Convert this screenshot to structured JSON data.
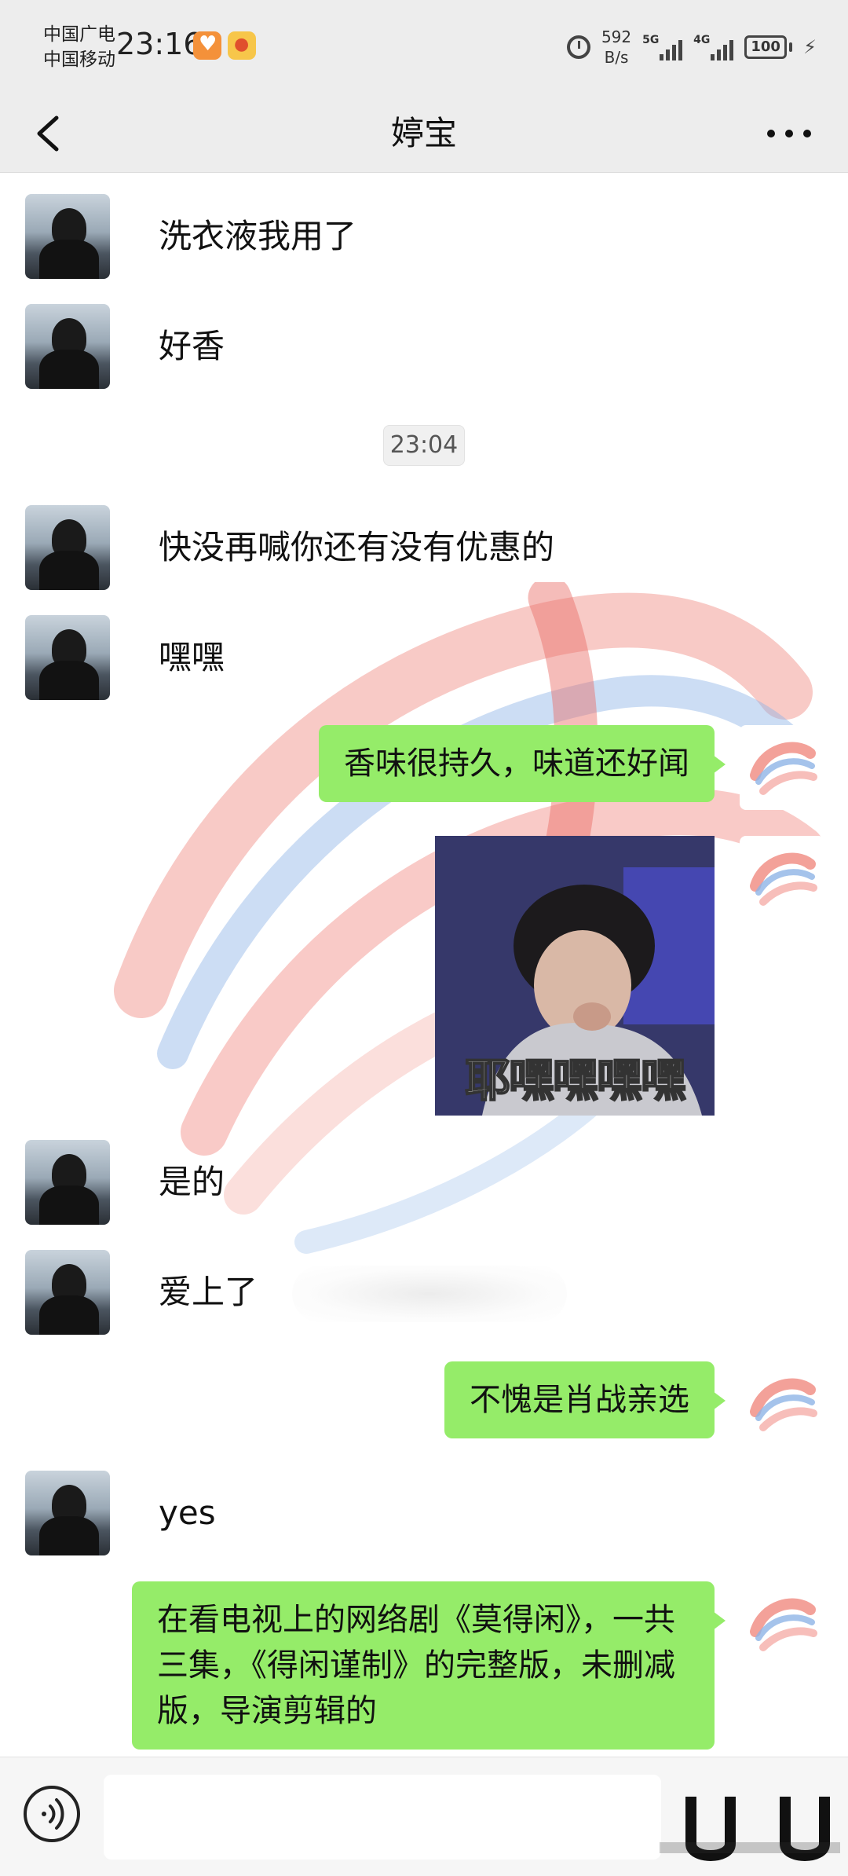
{
  "status_bar": {
    "carrier_line1": "中国广电",
    "carrier_line2": "中国移动",
    "time": "23:16",
    "net_speed_value": "592",
    "net_speed_unit": "B/s",
    "signal1_label": "5G",
    "signal2_label": "4G",
    "battery": "100",
    "icons": [
      "app-notification-icon",
      "weibo-icon",
      "alarm-icon",
      "signal-icon",
      "battery-icon",
      "charging-icon"
    ]
  },
  "nav": {
    "title": "婷宝",
    "back_icon": "back-arrow-icon",
    "more_icon": "more-dots-icon"
  },
  "messages": [
    {
      "side": "left",
      "text": "洗衣液我用了"
    },
    {
      "side": "left",
      "text": "好香"
    },
    {
      "type": "time",
      "text": "23:04"
    },
    {
      "side": "left",
      "text": "快没再喊你还有没有优惠的"
    },
    {
      "side": "left",
      "text": "嘿嘿"
    },
    {
      "side": "right",
      "text": "香味很持久，味道还好闻"
    },
    {
      "side": "right",
      "type": "sticker",
      "caption": "耶嘿嘿嘿嘿"
    },
    {
      "side": "left",
      "text": "是的"
    },
    {
      "side": "left",
      "text": "爱上了"
    },
    {
      "side": "right",
      "text": "不愧是肖战亲选"
    },
    {
      "side": "left",
      "text": "yes"
    },
    {
      "side": "right",
      "text": "在看电视上的网络剧《莫得闲》，一共三集，《得闲谨制》的完整版，未删减版，导演剪辑的"
    }
  ],
  "input_bar": {
    "voice_icon": "voice-wave-icon",
    "input_value": ""
  },
  "colors": {
    "header_bg": "#ededed",
    "bubble_green": "#95ec69",
    "chat_bg": "#ffffff"
  }
}
